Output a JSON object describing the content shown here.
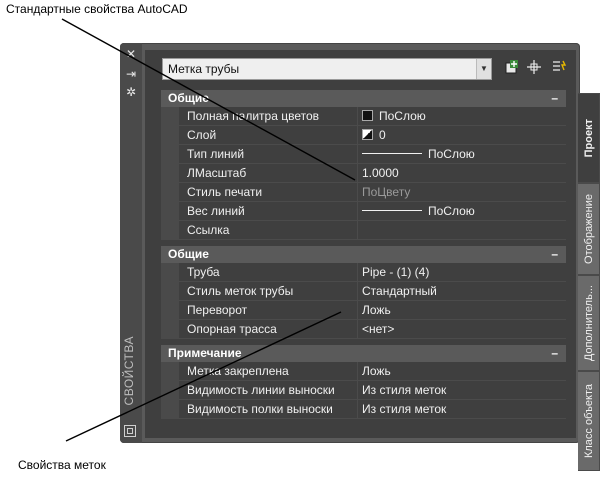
{
  "annotations": {
    "top_label": "Стандартные свойства AutoCAD",
    "bottom_label": "Свойства меток"
  },
  "palette": {
    "title_vertical": "СВОЙСТВА",
    "selector_value": "Метка трубы",
    "tabs": [
      "Проект",
      "Отображение",
      "Дополнитель...",
      "Класс объекта"
    ],
    "sections": [
      {
        "title": "Общие",
        "collapse": "–",
        "rows": [
          {
            "name": "Полная палитра цветов",
            "value": "ПоСлою",
            "swatch": "color"
          },
          {
            "name": "Слой",
            "value": "0",
            "swatch": "layer"
          },
          {
            "name": "Тип линий",
            "value": "ПоСлою",
            "swatch": "line"
          },
          {
            "name": "ЛМасштаб",
            "value": "1.0000"
          },
          {
            "name": "Стиль печати",
            "value": "ПоЦвету",
            "dim": true
          },
          {
            "name": "Вес линий",
            "value": "ПоСлою",
            "swatch": "line"
          },
          {
            "name": "Ссылка",
            "value": ""
          }
        ]
      },
      {
        "title": "Общие",
        "collapse": "–",
        "rows": [
          {
            "name": "Труба",
            "value": "Pipe - (1) (4)"
          },
          {
            "name": "Стиль меток трубы",
            "value": "Стандартный"
          },
          {
            "name": "Переворот",
            "value": "Ложь"
          },
          {
            "name": "Опорная трасса",
            "value": "<нет>"
          }
        ]
      },
      {
        "title": "Примечание",
        "collapse": "–",
        "rows": [
          {
            "name": "Метка закреплена",
            "value": "Ложь"
          },
          {
            "name": "Видимость линии выноски",
            "value": "Из стиля меток"
          },
          {
            "name": "Видимость полки выноски",
            "value": "Из стиля меток"
          }
        ]
      }
    ]
  },
  "colors": {
    "panel_bg": "#3f3f3f",
    "frame": "#5a5a5a",
    "section_header": "#5a5a5a",
    "text": "#f0f0f0"
  }
}
